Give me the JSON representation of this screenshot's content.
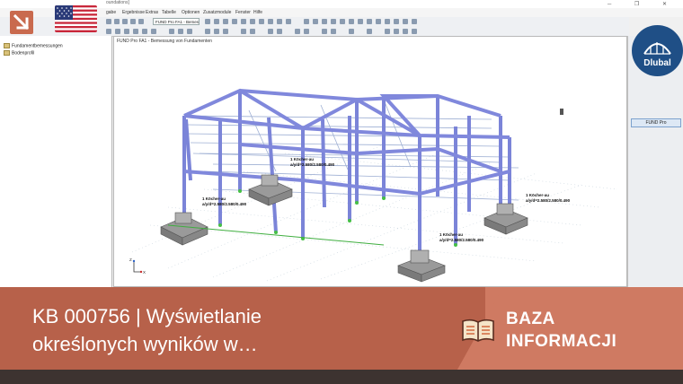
{
  "window": {
    "title_fragment": "oundations]",
    "controls": "─ ❐ ✕"
  },
  "menu": [
    "gabe",
    "Ergebnisse",
    "Extras",
    "Tabelle",
    "Optionen",
    "Zusatzmodule",
    "Fenster",
    "Hilfe"
  ],
  "toolbar": {
    "module_combo": "FUND Pro FA1 - Bemessung ...",
    "module_combo_full": "FUND Pro FA1 - Bemessung"
  },
  "navigator": {
    "items": [
      {
        "label": "Fundamentbemessungen"
      },
      {
        "label": "Bodenprofil"
      }
    ]
  },
  "viewport": {
    "title": "FUND Pro FA1 - Bemessung von Fundamenten",
    "annotations": [
      {
        "line1": "1 Köcher-au",
        "line2": "a/y/d=2.580/2.580/0.490"
      },
      {
        "line1": "1 Köcher-au",
        "line2": "a/y/d=2.580/2.580/0.490"
      },
      {
        "line1": "1 Köcher-au",
        "line2": "a/y/d=2.580/2.580/0.490"
      },
      {
        "line1": "1 Köcher-au",
        "line2": "a/y/d=2.580/2.580/0.490"
      }
    ],
    "axis": {
      "x": "X",
      "z": "Z"
    }
  },
  "right_panel": {
    "button": "FUND Pro"
  },
  "brand": {
    "logo_text": "Dlubal",
    "logo_color": "#1f4f86"
  },
  "banner": {
    "title_line1": "KB 000756 | Wyświetlanie",
    "title_line2": "określonych wyników w…",
    "category_line1": "BAZA",
    "category_line2": "INFORMACJI",
    "color_left": "#b7614a",
    "color_right": "#cf7a62"
  }
}
